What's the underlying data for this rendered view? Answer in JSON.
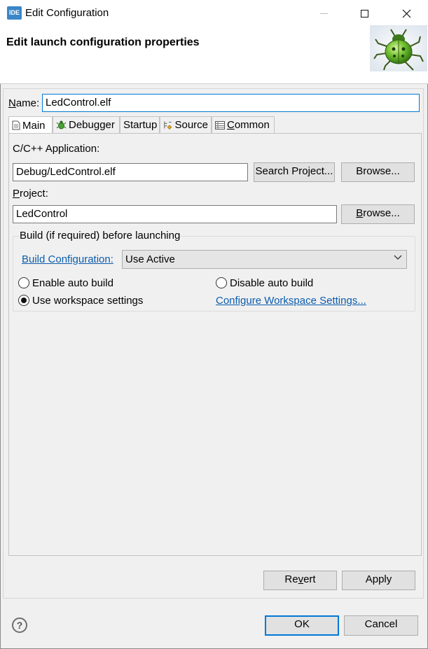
{
  "window": {
    "app_icon_text": "IDE",
    "title": "Edit Configuration"
  },
  "header": {
    "title": "Edit launch configuration properties",
    "icon": "bug-icon"
  },
  "name": {
    "label_underlined": "N",
    "label_rest": "ame:",
    "value": "LedControl.elf"
  },
  "tabs": [
    {
      "label": "Main",
      "icon": "page-icon",
      "active": true
    },
    {
      "label": "Debugger",
      "icon": "bug-small-icon",
      "active": false
    },
    {
      "label": "Startup",
      "icon": "",
      "active": false
    },
    {
      "label": "Source",
      "icon": "source-icon",
      "active": false
    },
    {
      "label_underlined": "C",
      "label_rest": "ommon",
      "icon": "table-icon",
      "active": false
    }
  ],
  "main": {
    "application_label": "C/C++ Application:",
    "application_value": "Debug/LedControl.elf",
    "search_project_label": "Search Project...",
    "browse_label": "Browse...",
    "project_label_underlined": "P",
    "project_label_rest": "roject:",
    "project_value": "LedControl",
    "browse2_underlined": "B",
    "browse2_rest": "rowse...",
    "build_group_title": "Build (if required) before launching",
    "build_config_link": "Build Configuration:",
    "build_config_value": "Use Active",
    "radio_enable": "Enable auto build",
    "radio_disable": "Disable auto build",
    "radio_workspace": "Use workspace settings",
    "configure_link": "Configure Workspace Settings...",
    "selected_radio": "workspace"
  },
  "footer": {
    "revert_prefix": "Re",
    "revert_underlined": "v",
    "revert_suffix": "ert",
    "apply_label": "Apply",
    "ok_label": "OK",
    "cancel_label": "Cancel",
    "help_glyph": "?"
  }
}
